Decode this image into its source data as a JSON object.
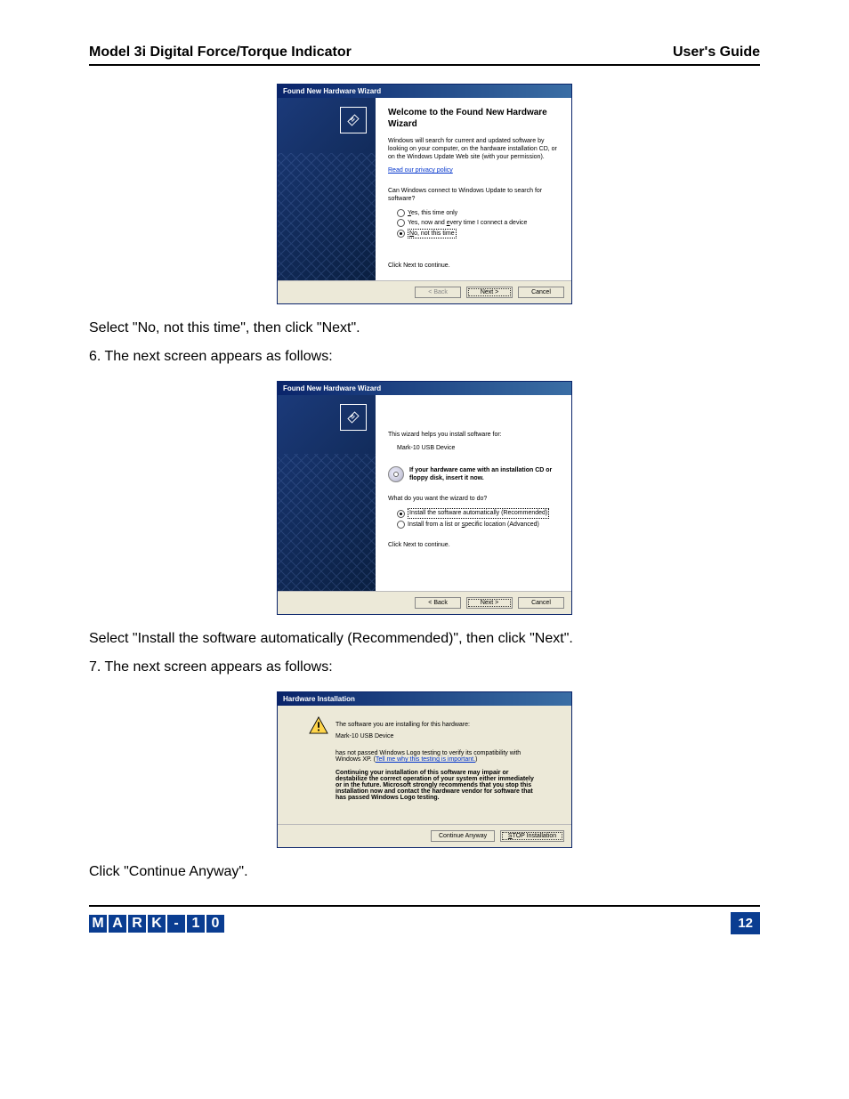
{
  "header": {
    "left": "Model 3i Digital Force/Torque Indicator",
    "right": "User's Guide"
  },
  "instructions": {
    "step5_suffix": "Select \"No, not this time\", then click \"Next\".",
    "step6_intro": "6. The next screen appears as follows:",
    "step6_suffix": "Select \"Install the software automatically (Recommended)\", then click \"Next\".",
    "step7_intro": "7. The next screen appears as follows:",
    "step7_suffix": "Click \"Continue Anyway\"."
  },
  "dialog1": {
    "title": "Found New Hardware Wizard",
    "heading": "Welcome to the Found New Hardware Wizard",
    "intro": "Windows will search for current and updated software by looking on your computer, on the hardware installation CD, or on the Windows Update Web site (with your permission).",
    "privacy_link": "Read our privacy policy",
    "question": "Can Windows connect to Windows Update to search for software?",
    "opt1_prefix": "Y",
    "opt1": "es, this time only",
    "opt2": "Yes, now and ",
    "opt2_u": "e",
    "opt2_suf": "very time I connect a device",
    "opt3_pre": "N",
    "opt3": "o, not this time",
    "next_prompt": "Click Next to continue.",
    "btn_back": "< Back",
    "btn_next": "Next >",
    "btn_cancel": "Cancel"
  },
  "dialog2": {
    "title": "Found New Hardware Wizard",
    "heading": "",
    "intro": "This wizard helps you install software for:",
    "device": "Mark-10 USB Device",
    "cd_note": "If your hardware came with an installation CD or floppy disk, insert it now.",
    "question": "What do you want the wizard to do?",
    "opt1": "Install the software automatically (Recommended)",
    "opt2_pre": "Install from a list or ",
    "opt2_u": "s",
    "opt2_suf": "pecific location (Advanced)",
    "next_prompt": "Click Next to continue.",
    "btn_back": "< Back",
    "btn_next": "Next >",
    "btn_cancel": "Cancel"
  },
  "dialog3": {
    "title": "Hardware Installation",
    "line1": "The software you are installing for this hardware:",
    "device": "Mark-10 USB Device",
    "line2_pre": "has not passed Windows Logo testing to verify its compatibility with Windows XP. (",
    "line2_link": "Tell me why this testing is important.",
    "line2_suf": ")",
    "bold_para": "Continuing your installation of this software may impair or destabilize the correct operation of your system either immediately or in the future. Microsoft strongly recommends that you stop this installation now and contact the hardware vendor for software that has passed Windows Logo testing.",
    "btn_continue": "Continue Anyway",
    "btn_stop_pre": "S",
    "btn_stop": "TOP Installation"
  },
  "footer": {
    "logo_chars": [
      "M",
      "A",
      "R",
      "K",
      "-",
      "1",
      "0"
    ],
    "page_number": "12"
  }
}
